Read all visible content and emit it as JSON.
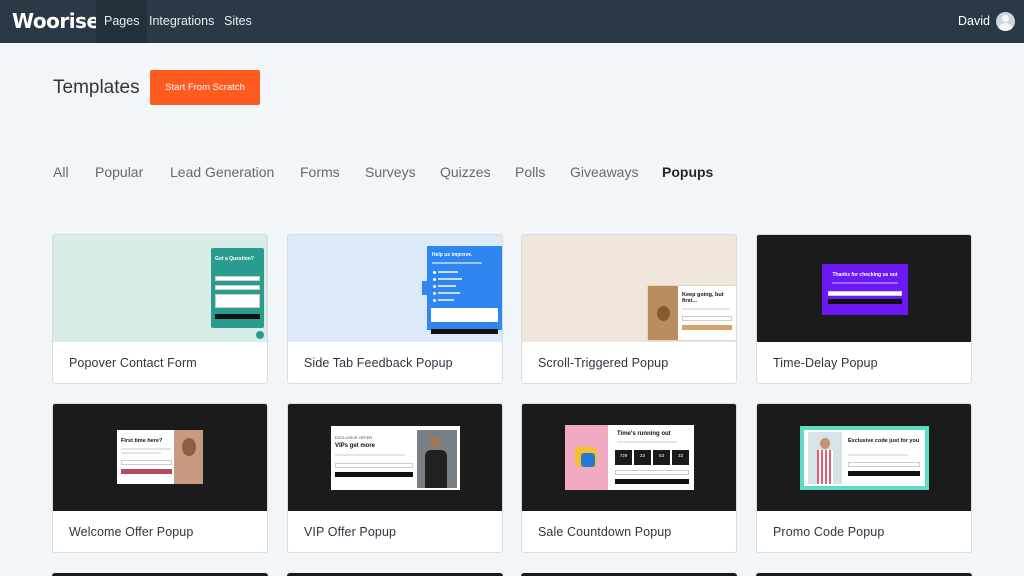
{
  "app": {
    "logo": "Woorise",
    "nav": [
      {
        "label": "Pages",
        "active": true
      },
      {
        "label": "Integrations",
        "active": false
      },
      {
        "label": "Sites",
        "active": false
      }
    ],
    "user": "David"
  },
  "header": {
    "title": "Templates",
    "scratch_button": "Start From Scratch"
  },
  "filters": [
    "All",
    "Popular",
    "Lead Generation",
    "Forms",
    "Surveys",
    "Quizzes",
    "Polls",
    "Giveaways",
    "Popups"
  ],
  "active_filter": "Popups",
  "cards": [
    {
      "label": "Popover Contact Form",
      "preview_title": "Got a Question?",
      "preview_button": "Submit"
    },
    {
      "label": "Side Tab Feedback Popup",
      "preview_title": "Help us improve.",
      "preview_button": "Submit"
    },
    {
      "label": "Scroll-Triggered Popup",
      "preview_title": "Keep going, but first...",
      "preview_button": "Subscribe"
    },
    {
      "label": "Time-Delay Popup",
      "preview_title": "Thanks for checking us out",
      "preview_button": "Subscribe"
    },
    {
      "label": "Welcome Offer Popup",
      "preview_title": "First time here?",
      "preview_button": "Claim offer"
    },
    {
      "label": "VIP Offer Popup",
      "preview_title": "VIPs get more",
      "preview_kicker": "EXCLUSIVE OFFER",
      "preview_button": "Get Access"
    },
    {
      "label": "Sale Countdown Popup",
      "preview_title": "Time's running out",
      "countdown": [
        "729",
        "23",
        "53",
        "33"
      ],
      "preview_button": "Get Discount"
    },
    {
      "label": "Promo Code Popup",
      "preview_title": "Exclusive code just for you",
      "preview_button": "Reveal Code"
    }
  ],
  "colors": {
    "nav_bg": "#2b3947",
    "accent": "#ff5a1f",
    "teal": "#2a9c8f",
    "blue": "#2f86f0",
    "purple": "#6c19f5"
  }
}
